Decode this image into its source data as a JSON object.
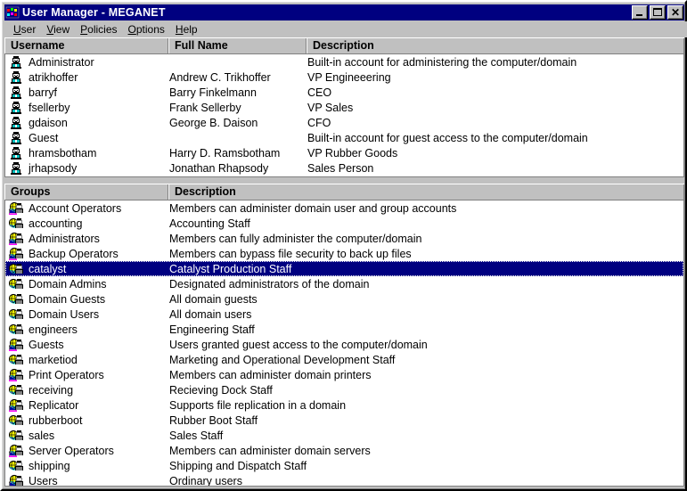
{
  "window": {
    "title": "User Manager - MEGANET",
    "icon": "user-manager-icon",
    "buttons": {
      "minimize": "_",
      "maximize": "□",
      "close": "×"
    }
  },
  "menu": {
    "items": [
      {
        "label": "User",
        "accel": "U"
      },
      {
        "label": "View",
        "accel": "V"
      },
      {
        "label": "Policies",
        "accel": "P"
      },
      {
        "label": "Options",
        "accel": "O"
      },
      {
        "label": "Help",
        "accel": "H"
      }
    ]
  },
  "users_pane": {
    "columns": [
      "Username",
      "Full Name",
      "Description"
    ],
    "rows": [
      {
        "icon": "user-icon",
        "username": "Administrator",
        "fullname": "",
        "description": "Built-in account for administering the computer/domain",
        "selected": false
      },
      {
        "icon": "user-icon",
        "username": "atrikhoffer",
        "fullname": "Andrew C. Trikhoffer",
        "description": "VP Engineeering",
        "selected": false
      },
      {
        "icon": "user-icon",
        "username": "barryf",
        "fullname": "Barry Finkelmann",
        "description": "CEO",
        "selected": false
      },
      {
        "icon": "user-icon",
        "username": "fsellerby",
        "fullname": "Frank Sellerby",
        "description": "VP Sales",
        "selected": false
      },
      {
        "icon": "user-icon",
        "username": "gdaison",
        "fullname": "George B. Daison",
        "description": "CFO",
        "selected": false
      },
      {
        "icon": "user-icon",
        "username": "Guest",
        "fullname": "",
        "description": "Built-in account for guest access to the computer/domain",
        "selected": false
      },
      {
        "icon": "user-icon",
        "username": "hramsbotham",
        "fullname": "Harry D. Ramsbotham",
        "description": "VP Rubber Goods",
        "selected": false
      },
      {
        "icon": "user-icon",
        "username": "jrhapsody",
        "fullname": "Jonathan Rhapsody",
        "description": "Sales Person",
        "selected": false
      }
    ]
  },
  "groups_pane": {
    "columns": [
      "Groups",
      "Description"
    ],
    "rows": [
      {
        "icon": "local-group-icon",
        "name": "Account Operators",
        "description": "Members can administer domain user and group accounts",
        "selected": false
      },
      {
        "icon": "global-group-icon",
        "name": "accounting",
        "description": "Accounting Staff",
        "selected": false
      },
      {
        "icon": "local-group-icon",
        "name": "Administrators",
        "description": "Members can fully administer the computer/domain",
        "selected": false
      },
      {
        "icon": "local-group-icon",
        "name": "Backup Operators",
        "description": "Members can bypass file security to back up files",
        "selected": false
      },
      {
        "icon": "global-group-icon",
        "name": "catalyst",
        "description": "Catalyst Production Staff",
        "selected": true
      },
      {
        "icon": "global-group-icon",
        "name": "Domain Admins",
        "description": "Designated administrators of the domain",
        "selected": false
      },
      {
        "icon": "global-group-icon",
        "name": "Domain Guests",
        "description": "All domain guests",
        "selected": false
      },
      {
        "icon": "global-group-icon",
        "name": "Domain Users",
        "description": "All domain users",
        "selected": false
      },
      {
        "icon": "global-group-icon",
        "name": "engineers",
        "description": "Engineering Staff",
        "selected": false
      },
      {
        "icon": "local-group-icon",
        "name": "Guests",
        "description": "Users granted guest access to the computer/domain",
        "selected": false
      },
      {
        "icon": "global-group-icon",
        "name": "marketiod",
        "description": "Marketing and Operational Development Staff",
        "selected": false
      },
      {
        "icon": "local-group-icon",
        "name": "Print Operators",
        "description": "Members can administer domain printers",
        "selected": false
      },
      {
        "icon": "global-group-icon",
        "name": "receiving",
        "description": "Recieving Dock Staff",
        "selected": false
      },
      {
        "icon": "local-group-icon",
        "name": "Replicator",
        "description": "Supports file replication in a domain",
        "selected": false
      },
      {
        "icon": "global-group-icon",
        "name": "rubberboot",
        "description": "Rubber Boot Staff",
        "selected": false
      },
      {
        "icon": "global-group-icon",
        "name": "sales",
        "description": "Sales Staff",
        "selected": false
      },
      {
        "icon": "local-group-icon",
        "name": "Server Operators",
        "description": "Members can administer domain servers",
        "selected": false
      },
      {
        "icon": "global-group-icon",
        "name": "shipping",
        "description": "Shipping and Dispatch Staff",
        "selected": false
      },
      {
        "icon": "local-group-icon",
        "name": "Users",
        "description": "Ordinary users",
        "selected": false
      }
    ]
  },
  "colors": {
    "titlebar": "#000080",
    "selection": "#000080",
    "selection_text": "#ffffff",
    "face": "#c0c0c0",
    "list_background": "#ffffff",
    "text": "#000000"
  }
}
